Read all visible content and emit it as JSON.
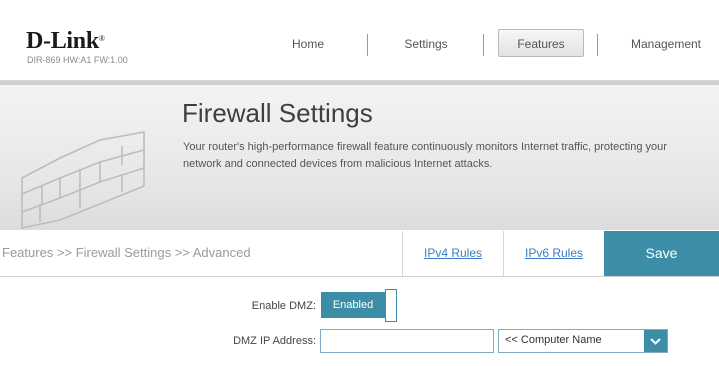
{
  "header": {
    "brand": "D-Link",
    "brand_mark": "®",
    "hw_info": "DIR-869 HW:A1 FW:1.00",
    "nav": [
      {
        "label": "Home"
      },
      {
        "label": "Settings"
      },
      {
        "label": "Features",
        "active": true
      },
      {
        "label": "Management"
      }
    ]
  },
  "banner": {
    "title": "Firewall Settings",
    "description": "Your router's high-performance firewall feature continuously monitors Internet traffic, protecting your network and connected devices from malicious Internet attacks.",
    "icon": "brick-wall-icon"
  },
  "subnav": {
    "breadcrumb": "Features >> Firewall Settings >> Advanced",
    "ipv4_rules": "IPv4 Rules",
    "ipv6_rules": "IPv6 Rules",
    "save": "Save"
  },
  "form": {
    "dmz_label": "Enable DMZ:",
    "dmz_state": "Enabled",
    "ip_label": "DMZ IP Address:",
    "ip_value": "",
    "computer_select": "<< Computer Name",
    "dropdown_icon": "chevron-down-icon"
  },
  "colors": {
    "accent": "#3b8ea6",
    "link": "#3b7cc4"
  }
}
